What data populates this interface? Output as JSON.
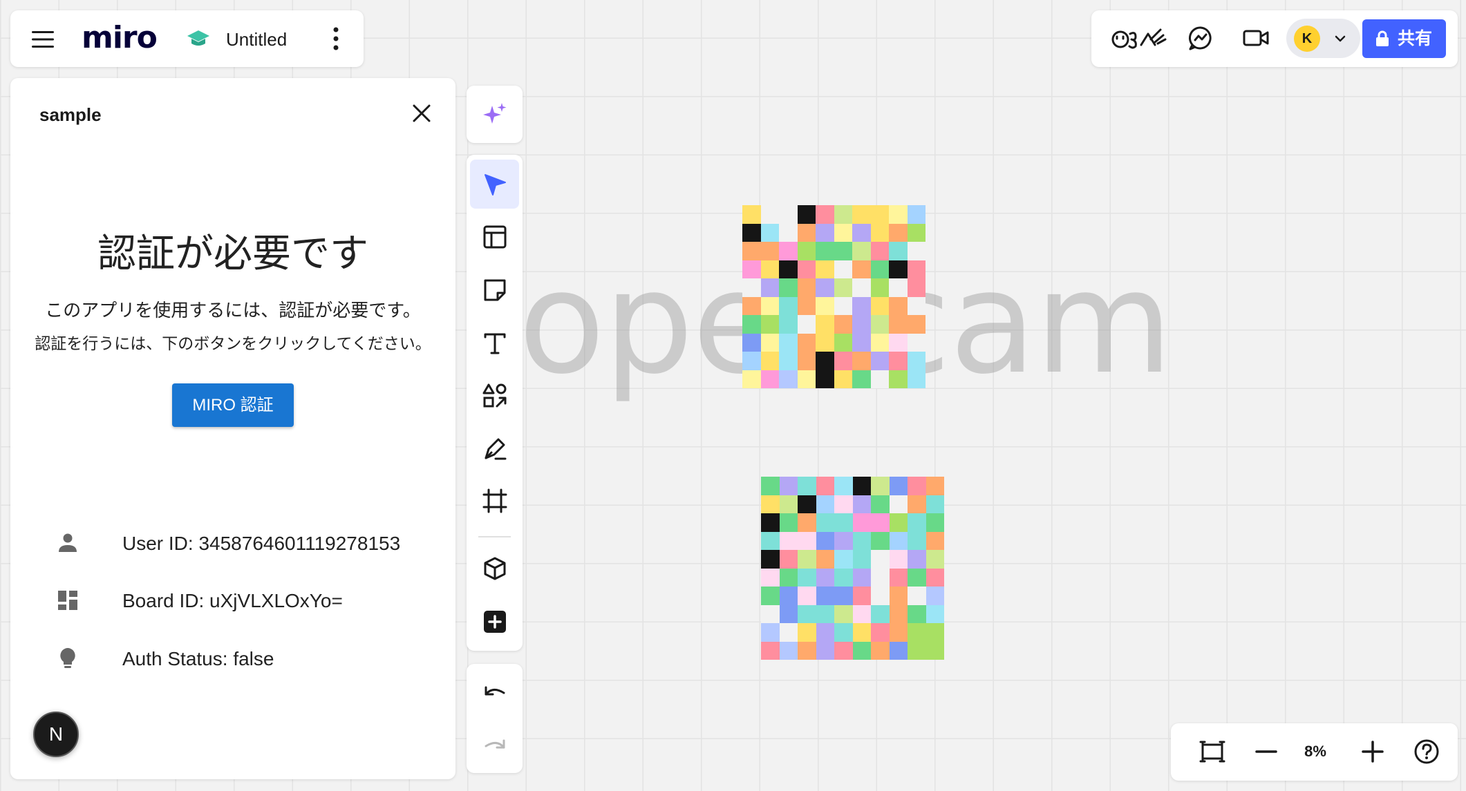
{
  "header": {
    "logo": "miro",
    "board_title": "Untitled"
  },
  "topbar_right": {
    "avatar_initial": "K",
    "share_label": "共有"
  },
  "panel": {
    "title": "sample",
    "heading": "認証が必要です",
    "description_1": "このアプリを使用するには、認証が必要です。",
    "description_2": "認証を行うには、下のボタンをクリックしてください。",
    "auth_button_label": "MIRO 認証",
    "info": {
      "user_id": "User ID: 3458764601119278153",
      "board_id": "Board ID: uXjVLXLOxYo=",
      "auth_status": "Auth Status: false"
    }
  },
  "nextjs_badge": "N",
  "canvas": {
    "watermark_text": "operlcam"
  },
  "zoom": {
    "level": "8%"
  },
  "colors": {
    "brand_blue": "#4262ff",
    "auth_button": "#1976d2",
    "avatar": "#ffd02f",
    "ai_purple": "#9b6cf5"
  },
  "mosaics": [
    [
      "#ffe066",
      "#f2f2f2",
      "#f2f2f2",
      "#151515",
      "#ff8e9e",
      "#cde98e",
      "#ffe066",
      "#ffe066",
      "#fff59b",
      "#a4d3ff",
      "#151515",
      "#9be5f6",
      "#f2f2f2",
      "#ffa96b",
      "#b4a7f5",
      "#fff59b",
      "#b4a7f5",
      "#ffe066",
      "#ffa96b",
      "#a8e063",
      "#ffa96b",
      "#ffa96b",
      "#ff9ad9",
      "#a8e063",
      "#68d988",
      "#68d988",
      "#cde98e",
      "#ff8e9e",
      "#7ee0d8",
      "#f2f2f2",
      "#ff9ad9",
      "#ffe066",
      "#151515",
      "#ff8e9e",
      "#ffe066",
      "#f2f2f2",
      "#ffa96b",
      "#68d988",
      "#151515",
      "#ff8e9e",
      "#f2f2f2",
      "#b4a7f5",
      "#68d988",
      "#ffa96b",
      "#b4a7f5",
      "#cde98e",
      "#f2f2f2",
      "#a8e063",
      "#f2f2f2",
      "#ff8e9e",
      "#ffa96b",
      "#fff59b",
      "#7ee0d8",
      "#ffa96b",
      "#fff59b",
      "#f2f2f2",
      "#b4a7f5",
      "#ffe066",
      "#ffa96b",
      "#f2f2f2",
      "#68d988",
      "#a8e063",
      "#7ee0d8",
      "#f2f2f2",
      "#ffe066",
      "#ffa96b",
      "#b4a7f5",
      "#cde98e",
      "#ffa96b",
      "#ffa96b",
      "#7d9bf5",
      "#fff59b",
      "#9be5f6",
      "#ffa96b",
      "#ffe066",
      "#a8e063",
      "#b4a7f5",
      "#fff59b",
      "#ffd9f0",
      "#f2f2f2",
      "#a4d3ff",
      "#ffe066",
      "#9be5f6",
      "#ffa96b",
      "#151515",
      "#ff8e9e",
      "#ffa96b",
      "#b4a7f5",
      "#ff8e9e",
      "#9be5f6",
      "#fff59b",
      "#ff9ad9",
      "#b4c8ff",
      "#fff59b",
      "#151515",
      "#ffe066",
      "#68d988",
      "#f2f2f2",
      "#a8e063",
      "#9be5f6"
    ],
    [
      "#68d988",
      "#b4a7f5",
      "#7ee0d8",
      "#ff8e9e",
      "#9be5f6",
      "#151515",
      "#cde98e",
      "#7d9bf5",
      "#ff8e9e",
      "#ffa96b",
      "#ffe066",
      "#cde98e",
      "#151515",
      "#a4d3ff",
      "#ffd9f0",
      "#b4a7f5",
      "#68d988",
      "#f2f2f2",
      "#ffa96b",
      "#7ee0d8",
      "#151515",
      "#68d988",
      "#ffa96b",
      "#7ee0d8",
      "#7ee0d8",
      "#ff9ad9",
      "#ff9ad9",
      "#a8e063",
      "#7ee0d8",
      "#68d988",
      "#7ee0d8",
      "#ffd9f0",
      "#ffd9f0",
      "#7d9bf5",
      "#b4a7f5",
      "#7ee0d8",
      "#68d988",
      "#a4d3ff",
      "#7ee0d8",
      "#ffa96b",
      "#151515",
      "#ff8e9e",
      "#cde98e",
      "#ffa96b",
      "#9be5f6",
      "#7ee0d8",
      "#f2f2f2",
      "#ffd9f0",
      "#b4a7f5",
      "#cde98e",
      "#ffd9f0",
      "#68d988",
      "#7ee0d8",
      "#b4a7f5",
      "#7ee0d8",
      "#b4a7f5",
      "#f2f2f2",
      "#ff8e9e",
      "#68d988",
      "#ff8e9e",
      "#68d988",
      "#7d9bf5",
      "#ffd9f0",
      "#7d9bf5",
      "#7d9bf5",
      "#ff8e9e",
      "#f2f2f2",
      "#ffa96b",
      "#f2f2f2",
      "#b4c8ff",
      "#f2f2f2",
      "#7d9bf5",
      "#7ee0d8",
      "#7ee0d8",
      "#cde98e",
      "#ffd9f0",
      "#7ee0d8",
      "#ffa96b",
      "#68d988",
      "#9be5f6",
      "#b4c8ff",
      "#f2f2f2",
      "#ffe066",
      "#b4a7f5",
      "#7ee0d8",
      "#ffe066",
      "#ff8e9e",
      "#ffa96b",
      "#a8e063",
      "#a8e063",
      "#ff8e9e",
      "#b4c8ff",
      "#ffa96b",
      "#b4a7f5",
      "#ff8e9e",
      "#68d988",
      "#ffa96b",
      "#7d9bf5",
      "#a8e063",
      "#a8e063"
    ]
  ]
}
